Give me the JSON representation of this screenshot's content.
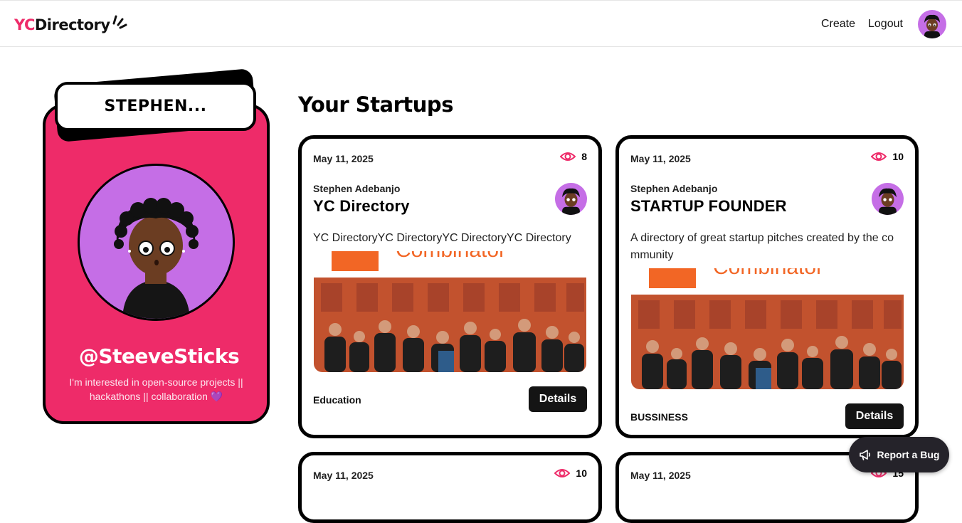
{
  "brand": {
    "yc": "YC",
    "rest": "Directory"
  },
  "nav": {
    "create": "Create",
    "logout": "Logout"
  },
  "profile": {
    "name": "STEPHEN...",
    "username": "@SteeveSticks",
    "bio": "I'm interested in open-source projects || hackathons || collaboration 💜"
  },
  "section_title": "Your Startups",
  "startups": [
    {
      "date": "May 11, 2025",
      "views": "8",
      "author": "Stephen Adebanjo",
      "title": "YC Directory",
      "description": "YC DirectoryYC DirectoryYC DirectoryYC Directory",
      "category": "Education",
      "details": "Details",
      "image_banner": "Combinator"
    },
    {
      "date": "May 11, 2025",
      "views": "10",
      "author": "Stephen Adebanjo",
      "title": "STARTUP FOUNDER",
      "description": "A directory of great startup pitches created by the co mmunity",
      "category": "BUSSINESS",
      "details": "Details",
      "image_banner": "Combinator"
    },
    {
      "date": "May 11, 2025",
      "views": "10"
    },
    {
      "date": "May 11, 2025",
      "views": "15"
    }
  ],
  "report": {
    "label": "Report a Bug"
  },
  "colors": {
    "accent": "#ee2b69",
    "avatar_bg": "#c56ee6",
    "dark": "#141414"
  }
}
